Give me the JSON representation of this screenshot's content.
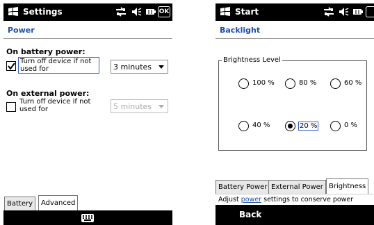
{
  "left_screen": {
    "title": "Settings",
    "ok_label": "OK",
    "page_title": "Power",
    "battery_section_label": "On battery power:",
    "battery_checkbox_label": "Turn off device if not used for",
    "battery_checked": true,
    "battery_timeout_value": "3 minutes",
    "external_section_label": "On external power:",
    "external_checkbox_label": "Turn off device if not used for",
    "external_checked": false,
    "external_timeout_value": "5 minutes",
    "tabs": [
      "Battery",
      "Advanced"
    ],
    "active_tab": "Advanced",
    "bottom_icon": "keyboard-icon"
  },
  "right_screen": {
    "title": "Start",
    "page_title": "Backlight",
    "group_label": "Brightness Level",
    "brightness_options": [
      "100 %",
      "80 %",
      "60 %",
      "40 %",
      "20 %",
      "0 %"
    ],
    "selected_brightness": "20 %",
    "tabs": [
      "Battery Power",
      "External Power",
      "Brightness"
    ],
    "active_tab": "Brightness",
    "hint_prefix": "Adjust ",
    "hint_link": "power",
    "hint_suffix": " settings to conserve power",
    "softkey_label": "Back"
  },
  "icons": {
    "windows_flag": "windows-flag-icon",
    "connectivity": "connectivity-icon",
    "volume": "volume-icon",
    "battery": "battery-icon"
  },
  "colors": {
    "accent_blue": "#1a4fae",
    "titlebar": "#000000"
  }
}
